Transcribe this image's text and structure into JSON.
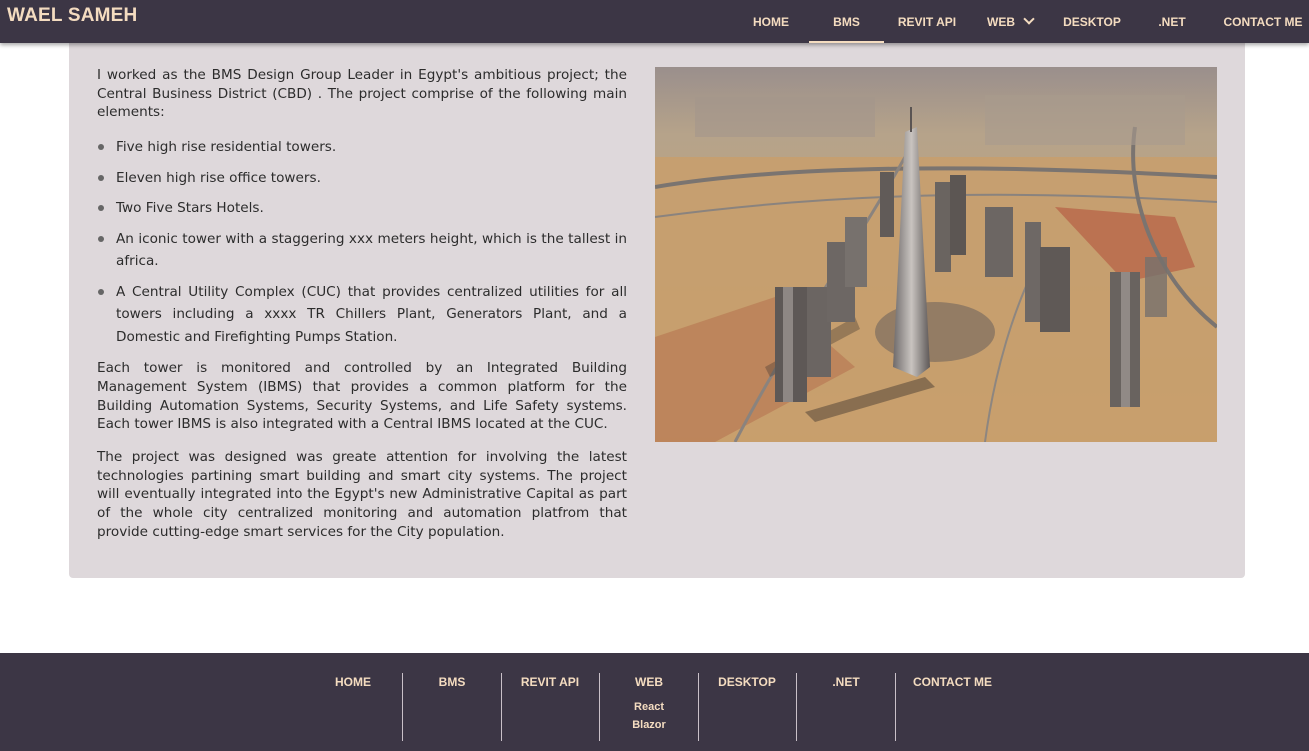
{
  "brand": "WAEL SAMEH",
  "nav": {
    "home": "HOME",
    "bms": "BMS",
    "revit": "REVIT API",
    "web": "WEB",
    "desktop": "DESKTOP",
    "net": ".NET",
    "contact": "CONTACT ME"
  },
  "content": {
    "intro": "I worked as the BMS Design Group Leader in Egypt's ambitious project; the Central Business District (CBD) . The project comprise of the following main elements:",
    "bullets": [
      "Five high rise residential towers.",
      "Eleven high rise office towers.",
      "Two Five Stars Hotels.",
      "An iconic tower with a staggering xxx meters height, which is the tallest in africa.",
      "A Central Utility Complex (CUC) that provides centralized utilities for all towers including a xxxx TR Chillers Plant, Generators Plant, and a Domestic and Firefighting Pumps Station."
    ],
    "para2": "Each tower is monitored and controlled by an Integrated Building Management System (IBMS) that provides a common platform for the Building Automation Systems, Security Systems, and Life Safety systems. Each tower IBMS is also integrated with a Central IBMS located at the CUC.",
    "para3": "The project was designed was greate attention for involving the latest technologies partining smart building and smart city systems. The project will eventually integrated into the Egypt's new Administrative Capital as part of the whole city centralized monitoring and automation platfrom that provide cutting-edge smart services for the City population."
  },
  "footer": {
    "home": "HOME",
    "bms": "BMS",
    "revit": "REVIT API",
    "web": "WEB",
    "web_sub": [
      "React",
      "Blazor"
    ],
    "desktop": "DESKTOP",
    "net": ".NET",
    "contact": "CONTACT ME"
  },
  "colors": {
    "bar": "#3c3645",
    "accent_text": "#f4dcc0",
    "card": "#ded8db"
  },
  "icons": {
    "web_dropdown": "chevron-down-icon"
  }
}
